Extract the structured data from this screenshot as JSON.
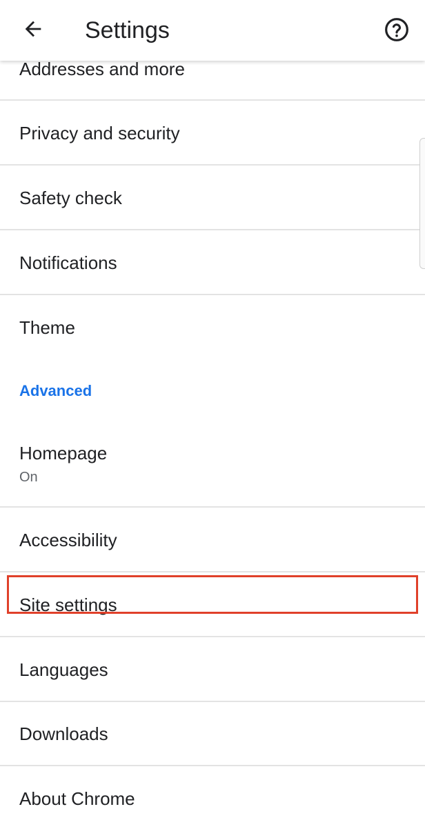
{
  "app_bar": {
    "title": "Settings",
    "back_icon": "arrow-left-icon",
    "help_icon": "help-circle-icon"
  },
  "items": {
    "addresses": "Addresses and more",
    "privacy": "Privacy and security",
    "safety": "Safety check",
    "notifications": "Notifications",
    "theme": "Theme",
    "advanced_header": "Advanced",
    "homepage": "Homepage",
    "homepage_status": "On",
    "accessibility": "Accessibility",
    "site_settings": "Site settings",
    "languages": "Languages",
    "downloads": "Downloads",
    "about": "About Chrome"
  },
  "colors": {
    "accent": "#1a73e8",
    "highlight": "#e0402a",
    "text": "#202124",
    "secondary_text": "#5f6368",
    "divider": "#e3e3e3"
  }
}
